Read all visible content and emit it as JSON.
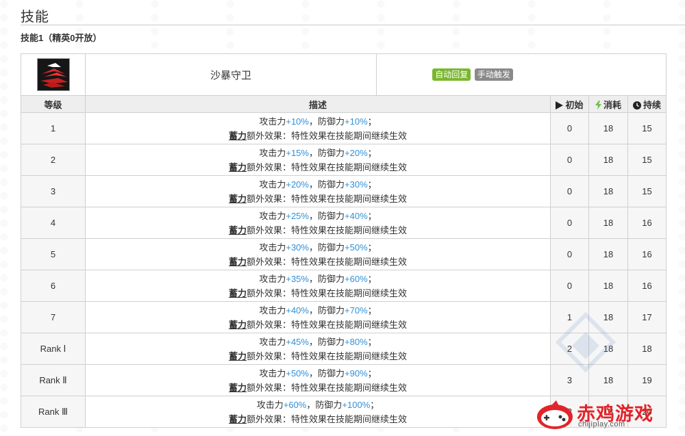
{
  "section": {
    "title": "技能",
    "subtitle": "技能1（精英0开放）"
  },
  "skill": {
    "name": "沙暴守卫",
    "tags": [
      "自动回复",
      "手动触发"
    ],
    "icon": "skill-icon"
  },
  "table": {
    "headers": {
      "level": "等级",
      "description": "描述",
      "initial": "初始",
      "cost": "消耗",
      "duration": "持续"
    },
    "desc_static": {
      "atk": "攻击力",
      "comma": "，",
      "def": "防御力",
      "semi": "；",
      "charge_word": "蓄力",
      "charge_rest": "额外效果：特性效果在技能期间继续生效"
    },
    "rows": [
      {
        "level": "1",
        "atk": "+10%",
        "def": "+10%",
        "initial": "0",
        "cost": "18",
        "duration": "15"
      },
      {
        "level": "2",
        "atk": "+15%",
        "def": "+20%",
        "initial": "0",
        "cost": "18",
        "duration": "15"
      },
      {
        "level": "3",
        "atk": "+20%",
        "def": "+30%",
        "initial": "0",
        "cost": "18",
        "duration": "15"
      },
      {
        "level": "4",
        "atk": "+25%",
        "def": "+40%",
        "initial": "0",
        "cost": "18",
        "duration": "16"
      },
      {
        "level": "5",
        "atk": "+30%",
        "def": "+50%",
        "initial": "0",
        "cost": "18",
        "duration": "16"
      },
      {
        "level": "6",
        "atk": "+35%",
        "def": "+60%",
        "initial": "0",
        "cost": "18",
        "duration": "16"
      },
      {
        "level": "7",
        "atk": "+40%",
        "def": "+70%",
        "initial": "1",
        "cost": "18",
        "duration": "17"
      },
      {
        "level": "Rank Ⅰ",
        "atk": "+45%",
        "def": "+80%",
        "initial": "2",
        "cost": "18",
        "duration": "18"
      },
      {
        "level": "Rank Ⅱ",
        "atk": "+50%",
        "def": "+90%",
        "initial": "3",
        "cost": "18",
        "duration": "19"
      },
      {
        "level": "Rank Ⅲ",
        "atk": "+60%",
        "def": "+100%",
        "initial": "3",
        "cost": "18",
        "duration": "20"
      }
    ]
  },
  "watermark": {
    "brand": "赤鸡游戏",
    "url": "chijiplay.com",
    "faint": "MOONCELL"
  },
  "colors": {
    "blue": "#2f90d8",
    "green_tag": "#7ab72e",
    "gray_tag": "#8a8a8a",
    "brand_red": "#e2242a"
  }
}
